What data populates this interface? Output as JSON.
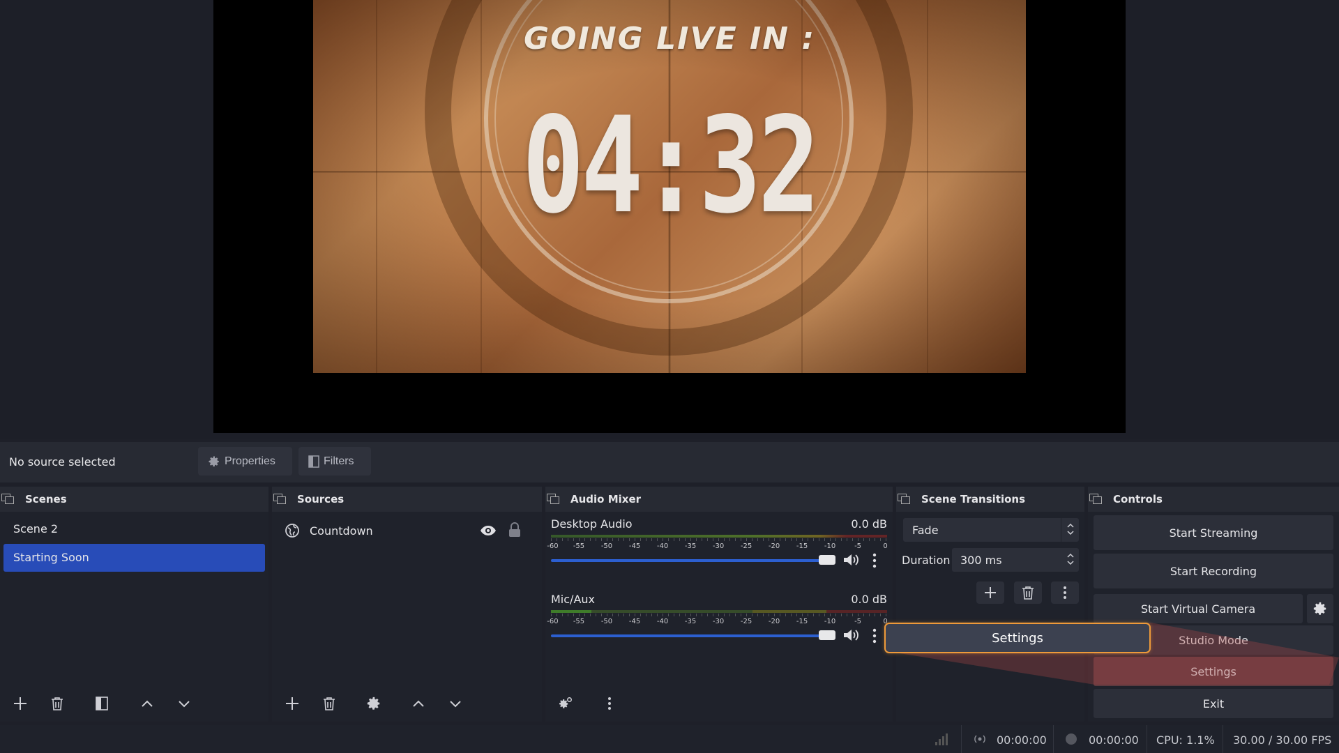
{
  "preview": {
    "heading": "GOING LIVE IN :",
    "timer": "04:32"
  },
  "context_bar": {
    "selection_label": "No source selected",
    "properties_label": "Properties",
    "filters_label": "Filters"
  },
  "scenes": {
    "title": "Scenes",
    "items": [
      {
        "label": "Scene 2",
        "active": false
      },
      {
        "label": "Starting Soon",
        "active": true
      }
    ]
  },
  "sources": {
    "title": "Sources",
    "items": [
      {
        "label": "Countdown",
        "icon": "globe-icon",
        "visible": true,
        "locked": false
      }
    ]
  },
  "audio_mixer": {
    "title": "Audio Mixer",
    "ticks": [
      "-60",
      "-55",
      "-50",
      "-45",
      "-40",
      "-35",
      "-30",
      "-25",
      "-20",
      "-15",
      "-10",
      "-5",
      "0"
    ],
    "channels": [
      {
        "name": "Desktop Audio",
        "level": "0.0 dB"
      },
      {
        "name": "Mic/Aux",
        "level": "0.0 dB"
      }
    ]
  },
  "scene_transitions": {
    "title": "Scene Transitions",
    "selected": "Fade",
    "duration_label": "Duration",
    "duration_value": "300 ms"
  },
  "controls": {
    "title": "Controls",
    "start_streaming": "Start Streaming",
    "start_recording": "Start Recording",
    "start_virtual_camera": "Start Virtual Camera",
    "studio_mode": "Studio Mode",
    "settings": "Settings",
    "exit": "Exit"
  },
  "callout": {
    "label": "Settings"
  },
  "status": {
    "stream_time": "00:00:00",
    "record_time": "00:00:00",
    "cpu": "CPU: 1.1%",
    "fps": "30.00 / 30.00 FPS"
  },
  "colors": {
    "accent": "#284cb8",
    "callout_border": "#ee9a3a",
    "highlight_button": "#5e3a3f"
  }
}
